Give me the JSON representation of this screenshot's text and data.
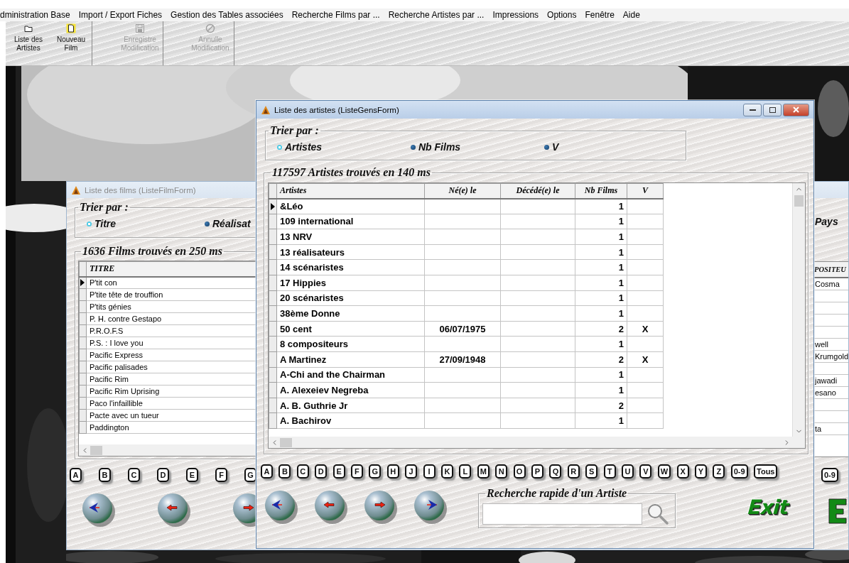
{
  "menu": [
    "dministration Base",
    "Import / Export Fiches",
    "Gestion des Tables associées",
    "Recherche Films par ...",
    "Recherche Artistes par ...",
    "Impressions",
    "Options",
    "Fenêtre",
    "Aide"
  ],
  "toolbar": [
    {
      "buttons": [
        {
          "kind": "folder",
          "label": "Liste des Artistes",
          "disabled": false
        },
        {
          "kind": "new",
          "label": "Nouveau Film",
          "disabled": false
        }
      ]
    },
    {
      "buttons": [
        {
          "kind": "save",
          "label": "Enregistre Modification",
          "disabled": true
        }
      ]
    },
    {
      "buttons": [
        {
          "kind": "cancel",
          "label": "Annulle Modification",
          "disabled": true
        }
      ]
    }
  ],
  "films_window": {
    "title": "Liste des films (ListeFilmForm)",
    "sort_label": "Trier par :",
    "sort_options": [
      {
        "label": "Titre",
        "selected": true
      },
      {
        "label": "Réalisat",
        "selected": false
      }
    ],
    "sort_option_right": "Pays",
    "result_label": "1636 Films trouvés en 250 ms",
    "columns": [
      "TITRE"
    ],
    "column_right": "POSITEU",
    "rows": [
      {
        "title": "P'tit con",
        "column_right": "Cosma",
        "selected": true
      },
      {
        "title": "P'tite tête de trouffion",
        "selected": false
      },
      {
        "title": "P'tits génies",
        "selected": false
      },
      {
        "title": "P. H. contre Gestapo",
        "selected": false
      },
      {
        "title": "P.R.O.F.S",
        "selected": false
      },
      {
        "title": "P.S. : I love you",
        "column_right": "well",
        "selected": false
      },
      {
        "title": "Pacific Express",
        "column_right": "Krumgold",
        "selected": false
      },
      {
        "title": "Pacific palisades",
        "selected": false
      },
      {
        "title": "Pacific Rim",
        "column_right": "jawadi",
        "selected": false
      },
      {
        "title": "Pacific Rim Uprising",
        "column_right": "esano",
        "selected": false
      },
      {
        "title": "Paco l'infaillible",
        "selected": false
      },
      {
        "title": "Pacte avec un tueur",
        "selected": false
      },
      {
        "title": "Paddington",
        "column_right": "ta",
        "selected": false
      }
    ],
    "letters": [
      "A",
      "B",
      "C",
      "D",
      "E",
      "F",
      "G"
    ],
    "letters_right": [
      "0-9"
    ],
    "nav": [
      {
        "kind": "first"
      },
      {
        "kind": "prev"
      },
      {
        "kind": "next"
      }
    ]
  },
  "artists_window": {
    "title": "Liste des artistes (ListeGensForm)",
    "sort_label": "Trier par :",
    "sort_options": [
      {
        "label": "Artistes",
        "selected": true
      },
      {
        "label": "Nb Films",
        "selected": false
      },
      {
        "label": "V",
        "selected": false
      }
    ],
    "result_label": "117597 Artistes trouvés en 140 ms",
    "columns": [
      "Artistes",
      "Né(e) le",
      "Décédé(e) le",
      "Nb Films",
      "V"
    ],
    "rows": [
      {
        "name": "&Léo",
        "films": "1",
        "selected": true
      },
      {
        "name": "109 international",
        "films": "1",
        "selected": false
      },
      {
        "name": "13 NRV",
        "films": "1",
        "selected": false
      },
      {
        "name": "13 réalisateurs",
        "films": "1",
        "selected": false
      },
      {
        "name": "14 scénaristes",
        "films": "1",
        "selected": false
      },
      {
        "name": "17 Hippies",
        "films": "1",
        "selected": false
      },
      {
        "name": "20 scénaristes",
        "films": "1",
        "selected": false
      },
      {
        "name": "38ème Donne",
        "films": "1",
        "selected": false
      },
      {
        "name": "50 cent",
        "born": "06/07/1975",
        "films": "2",
        "v": "X",
        "selected": false
      },
      {
        "name": "8 compositeurs",
        "films": "1",
        "selected": false
      },
      {
        "name": "A Martinez",
        "born": "27/09/1948",
        "films": "2",
        "v": "X",
        "selected": false
      },
      {
        "name": "A-Chi and the Chairman",
        "films": "1",
        "selected": false
      },
      {
        "name": "A. Alexeiev Negreba",
        "films": "1",
        "selected": false
      },
      {
        "name": "A. B. Guthrie Jr",
        "films": "2",
        "selected": false
      },
      {
        "name": "A. Bachirov",
        "films": "1",
        "selected": false
      }
    ],
    "letters": [
      "A",
      "B",
      "C",
      "D",
      "E",
      "F",
      "G",
      "H",
      "J",
      "I",
      "K",
      "L",
      "M",
      "N",
      "O",
      "P",
      "Q",
      "R",
      "S",
      "T",
      "U",
      "V",
      "W",
      "X",
      "Y",
      "Z",
      "0-9",
      "Tous"
    ],
    "nav": [
      {
        "kind": "first"
      },
      {
        "kind": "prev"
      },
      {
        "kind": "next"
      },
      {
        "kind": "last"
      }
    ],
    "search": {
      "label": "Recherche rapide d'un Artiste"
    },
    "exit": "Exit"
  }
}
